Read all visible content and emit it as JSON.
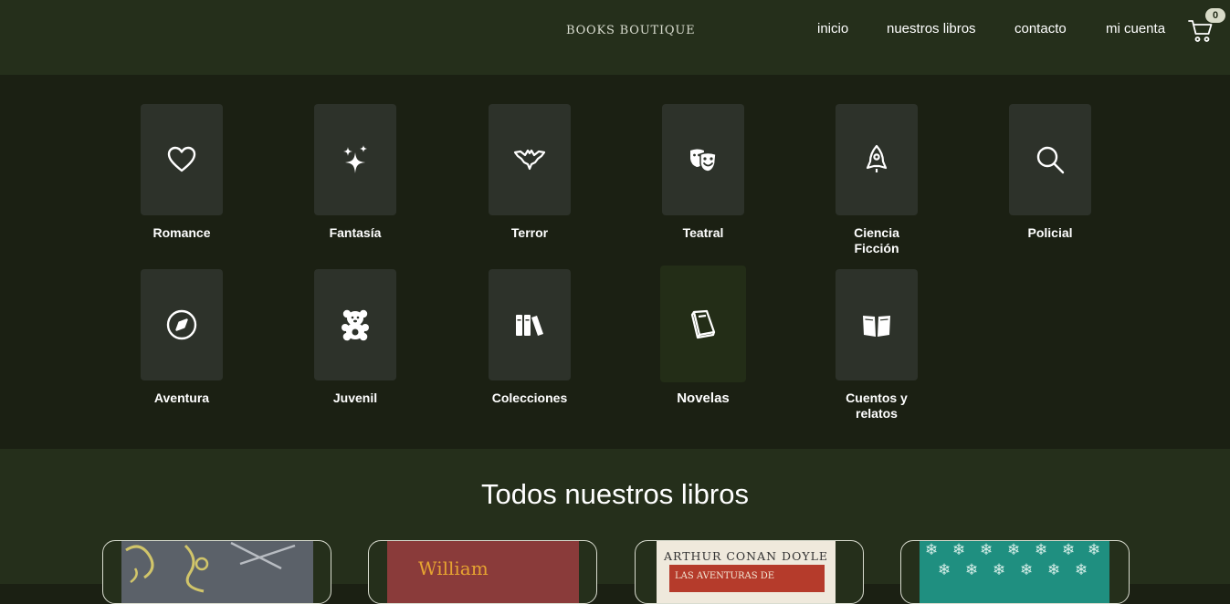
{
  "header": {
    "brand": "BOOKS BOUTIQUE",
    "nav": [
      "inicio",
      "nuestros libros",
      "contacto",
      "mi cuenta"
    ],
    "cart_count": "0",
    "cart_icon": "cart-icon"
  },
  "categories": [
    {
      "label": "Romance",
      "icon": "heart-icon"
    },
    {
      "label": "Fantasía",
      "icon": "sparkles-icon"
    },
    {
      "label": "Terror",
      "icon": "bat-icon"
    },
    {
      "label": "Teatral",
      "icon": "theater-masks-icon"
    },
    {
      "label": "Ciencia Ficción",
      "icon": "rocket-icon"
    },
    {
      "label": "Policial",
      "icon": "magnifier-icon"
    },
    {
      "label": "Aventura",
      "icon": "compass-icon"
    },
    {
      "label": "Juvenil",
      "icon": "teddy-bear-icon"
    },
    {
      "label": "Colecciones",
      "icon": "book-collection-icon"
    },
    {
      "label": "Novelas",
      "icon": "book-icon"
    },
    {
      "label": "Cuentos y relatos",
      "icon": "open-book-icon"
    }
  ],
  "books": {
    "title": "Todos nuestros libros",
    "items": [
      {
        "cover_text": ""
      },
      {
        "cover_text": "William"
      },
      {
        "cover_text": "ARTHUR CONAN DOYLE",
        "cover_subtext": "LAS AVENTURAS DE"
      },
      {
        "cover_text": ""
      }
    ]
  },
  "colors": {
    "header_bg": "#252f1b",
    "categories_bg": "#1b2013",
    "tile_bg": "#2d322a",
    "active_tile_bg": "#232d17"
  }
}
